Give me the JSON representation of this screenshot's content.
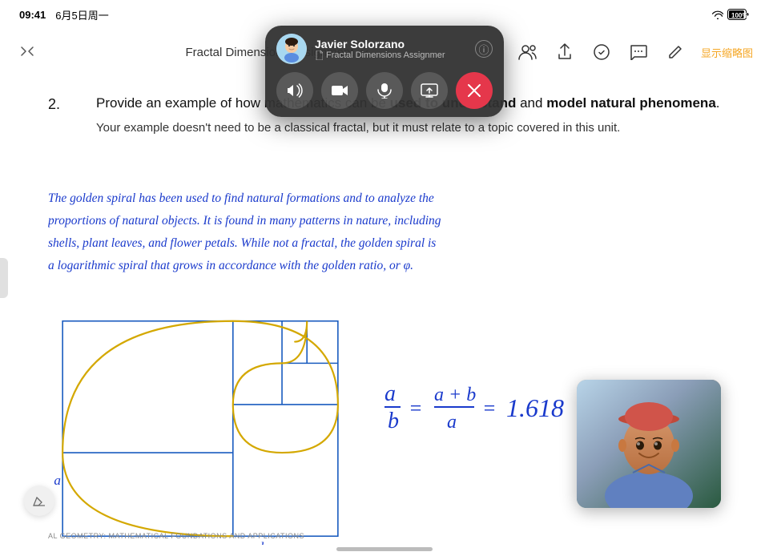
{
  "statusBar": {
    "time": "09:41",
    "date": "6月5日周一",
    "battery": "100%"
  },
  "toolbar": {
    "documentTitle": "Fractal Dimensions Assignment",
    "chevronIcon": "chevron-down",
    "showThumbnails": "显示缩略图",
    "icons": [
      "people-icon",
      "share-icon",
      "markup-icon",
      "comment-icon",
      "edit-icon"
    ]
  },
  "facetime": {
    "callerName": "Javier Solorzano",
    "document": "Fractal Dimensions Assignmer",
    "controls": [
      {
        "id": "volume",
        "label": "音量",
        "icon": "🔊"
      },
      {
        "id": "video",
        "label": "视频",
        "icon": "📷"
      },
      {
        "id": "mute",
        "label": "静音",
        "icon": "🎤"
      },
      {
        "id": "screen",
        "label": "共享屏幕",
        "icon": "📺"
      },
      {
        "id": "end",
        "label": "挂断",
        "icon": "✕"
      }
    ]
  },
  "content": {
    "questionNumber": "2.",
    "questionMain": "Provide an example of how mathematics can be used to understand and model natural phenomena.",
    "questionSub": "Your example doesn't need to be a classical fractal, but it must relate to a topic covered in this unit.",
    "handwrittenText": "The golden spiral has been used to find natural formations and to analyze the proportions of natural objects. It is found in many patterns in nature, including shells, plant leaves, and flower petals. While not a fractal, the golden spiral is a logarithmic spiral that grows in accordance with the golden ratio, or φ.",
    "formula": "a/b = (a+b)/a = 1.618",
    "bottomLabel": "AL GEOMETRY: MATHEMATICAL FOUNDATIONS AND APPLICATIONS",
    "axisA": "a",
    "axisA2": "a",
    "axisB": "b"
  },
  "colors": {
    "accent": "#f5a623",
    "handwriting": "#1a3acc",
    "endCall": "#e5374b",
    "background": "#ffffff"
  }
}
